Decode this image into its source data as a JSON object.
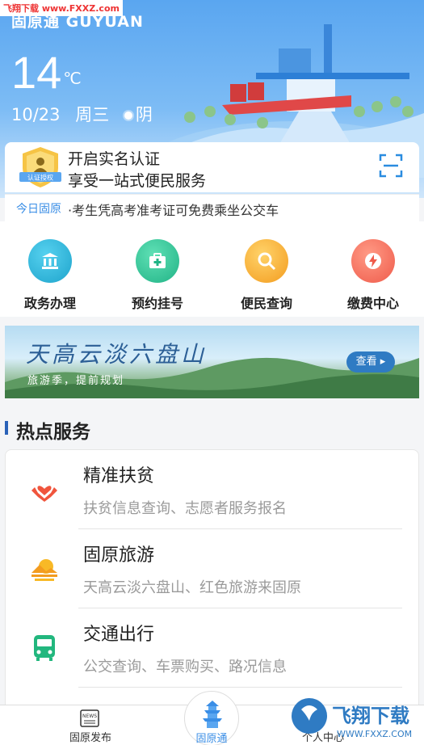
{
  "watermark": {
    "top_left": "飞翔下载 www.FXXZ.com",
    "bottom_right_cn": "飞翔下载",
    "bottom_right_en": "WWW.FXXZ.COM"
  },
  "header": {
    "brand_cn": "固原通",
    "brand_en": "GUYUAN"
  },
  "weather": {
    "temperature": "14",
    "unit": "℃",
    "date": "10/23",
    "weekday": "周三",
    "condition": "阴",
    "condition_icon": "sun-icon"
  },
  "auth": {
    "badge_text": "认证授权",
    "title": "开启实名认证",
    "subtitle": "享受一站式便民服务",
    "scan_icon": "scan-icon"
  },
  "news": {
    "tag": "今日固原",
    "text": "·考生凭高考准考证可免费乘坐公交车"
  },
  "quick_actions": [
    {
      "label": "政务办理",
      "icon": "government-icon",
      "color": "#27b3d6"
    },
    {
      "label": "预约挂号",
      "icon": "medical-kit-icon",
      "color": "#2bbf95"
    },
    {
      "label": "便民查询",
      "icon": "search-icon",
      "color": "#f6a623"
    },
    {
      "label": "缴费中心",
      "icon": "lightning-icon",
      "color": "#f26a5a"
    }
  ],
  "banner": {
    "title": "天高云淡六盘山",
    "subtitle": "旅游季，提前规划",
    "button": "查看"
  },
  "hot_services": {
    "title": "热点服务",
    "items": [
      {
        "title": "精准扶贫",
        "desc": "扶贫信息查询、志愿者服务报名",
        "icon": "heart-hands-icon"
      },
      {
        "title": "固原旅游",
        "desc": "天高云淡六盘山、红色旅游来固原",
        "icon": "sunset-icon"
      },
      {
        "title": "交通出行",
        "desc": "公交查询、车票购买、路况信息",
        "icon": "bus-icon"
      }
    ]
  },
  "tabbar": {
    "left": "固原发布",
    "center": "固原通",
    "right": "个人中心",
    "news_badge": "NEWS"
  },
  "colors": {
    "accent": "#3a8ee6",
    "hero_blue": "#5aa6f0",
    "section_bar": "#2a62b8"
  }
}
